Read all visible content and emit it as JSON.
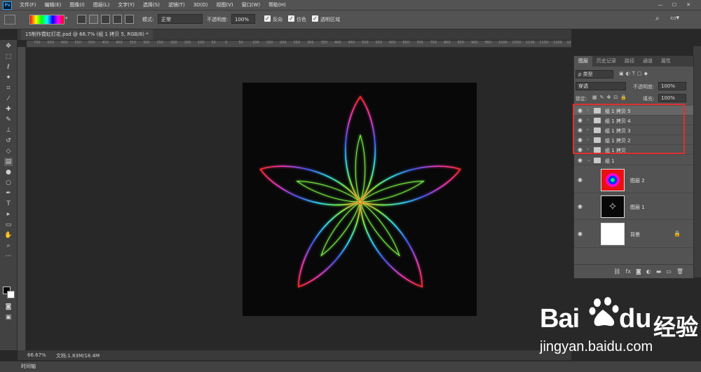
{
  "menubar": {
    "app_icon": "Ps",
    "items": [
      "文件(F)",
      "编辑(E)",
      "图像(I)",
      "图层(L)",
      "文字(Y)",
      "选择(S)",
      "滤镜(T)",
      "3D(D)",
      "视图(V)",
      "窗口(W)",
      "帮助(H)"
    ],
    "win": [
      "—",
      "☐",
      "✕"
    ]
  },
  "options": {
    "mode_label": "模式:",
    "mode_value": "正常",
    "opacity_label": "不透明度:",
    "opacity_value": "100%",
    "reverse_label": "反向",
    "dither_label": "仿色",
    "transparency_label": "透明区域"
  },
  "document": {
    "tab_title": "15制作霓虹灯花.psd @ 66.7% (组 1 拷贝 5, RGB/8) *"
  },
  "ruler": {
    "h_ticks": [
      "700",
      "650",
      "600",
      "550",
      "500",
      "450",
      "400",
      "350",
      "300",
      "250",
      "200",
      "150",
      "100",
      "50",
      "0",
      "50",
      "100",
      "150",
      "200",
      "250",
      "300",
      "350",
      "400",
      "450",
      "500",
      "550",
      "600",
      "650",
      "700",
      "750",
      "800",
      "850",
      "900",
      "950",
      "1000",
      "1050",
      "1100",
      "1150",
      "1200",
      "1250"
    ]
  },
  "status": {
    "zoom": "66.67%",
    "doc_info": "文档:1.83M/18.4M",
    "timeline_label": "时间轴"
  },
  "layers_panel": {
    "tabs": [
      "图层",
      "历史记录",
      "路径",
      "通道",
      "属性"
    ],
    "filter_label": "ρ 类型",
    "blend_mode": "穿透",
    "opacity_label": "不透明度:",
    "opacity_value": "100%",
    "lock_label": "锁定:",
    "fill_label": "填充:",
    "fill_value": "100%",
    "layers": [
      {
        "name": "组 1 拷贝 5"
      },
      {
        "name": "组 1 拷贝 4"
      },
      {
        "name": "组 1 拷贝 3"
      },
      {
        "name": "组 1 拷贝 2"
      },
      {
        "name": "组 1 拷贝"
      },
      {
        "name": "组 1"
      },
      {
        "name": "图层 2"
      },
      {
        "name": "图层 1"
      },
      {
        "name": "背景"
      }
    ],
    "bottom_icons": [
      "⛓",
      "fx",
      "◙",
      "◐",
      "▬",
      "▭",
      "🗑"
    ]
  },
  "watermark": {
    "bai": "Bai",
    "du": "du",
    "cn": "经验",
    "url": "jingyan.baidu.com"
  },
  "colors": {
    "selection_box": "#e03030",
    "accent": "#31a8ff"
  }
}
